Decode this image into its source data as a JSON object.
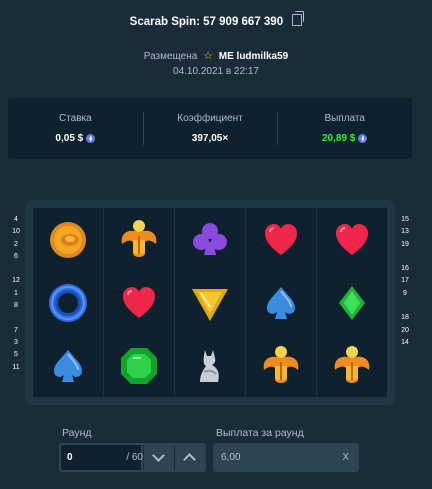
{
  "header": {
    "title": "Scarab Spin: 57 909 667 390",
    "copy_icon": "copy-icon"
  },
  "meta": {
    "placed_label": "Размещена",
    "rank": "ME",
    "username": "ludmilka59",
    "datetime": "04.10.2021 в 22:17"
  },
  "stats": {
    "bet": {
      "label": "Ставка",
      "value": "0,05 $"
    },
    "multiplier": {
      "label": "Коэффициент",
      "value": "397,05×"
    },
    "payout": {
      "label": "Выплата",
      "value": "20,89 $"
    }
  },
  "paylines": {
    "left": [
      "4",
      "10",
      "2",
      "6",
      "",
      "12",
      "1",
      "8",
      "",
      "7",
      "3",
      "5",
      "11"
    ],
    "right": [
      "15",
      "13",
      "19",
      "",
      "16",
      "17",
      "9",
      "",
      "18",
      "20",
      "14"
    ]
  },
  "reels": [
    [
      "coin-icon",
      "ring-icon",
      "spade-icon"
    ],
    [
      "scarab-icon",
      "heart-icon",
      "emerald-icon"
    ],
    [
      "club-icon",
      "triangle-gem-icon",
      "cat-statue-icon"
    ],
    [
      "heart-icon",
      "spade-icon",
      "scarab-icon"
    ],
    [
      "heart-icon",
      "diamond-icon",
      "scarab-icon"
    ]
  ],
  "round": {
    "label": "Раунд",
    "value": "0",
    "total": "/ 60"
  },
  "round_payout": {
    "label": "Выплата за раунд",
    "value": "6,00",
    "clear": "X"
  },
  "colors": {
    "background": "#1a2c38",
    "panel": "#0f212e",
    "green": "#1fff20",
    "accent": "#2f4553"
  }
}
